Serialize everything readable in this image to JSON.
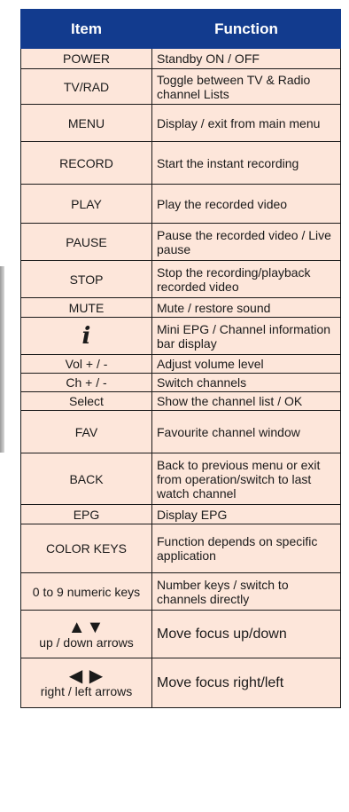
{
  "header": {
    "item": "Item",
    "function": "Function"
  },
  "rows": [
    {
      "item": "POWER",
      "function": "Standby ON / OFF"
    },
    {
      "item": "TV/RAD",
      "function": "Toggle between TV & Radio channel Lists"
    },
    {
      "item": "MENU",
      "function": "Display / exit from main menu"
    },
    {
      "item": "RECORD",
      "function": "Start the instant recording"
    },
    {
      "item": "PLAY",
      "function": "Play the recorded video"
    },
    {
      "item": "PAUSE",
      "function": "Pause the recorded video / Live pause"
    },
    {
      "item": "STOP",
      "function": "Stop the recording/playback recorded video"
    },
    {
      "item": "MUTE",
      "function": "Mute / restore sound"
    },
    {
      "item_icon": "info-i-icon",
      "item_glyph": "i",
      "function": "Mini EPG / Channel information bar display"
    },
    {
      "item": "Vol + / -",
      "function": "Adjust volume level"
    },
    {
      "item": "Ch + / -",
      "function": "Switch channels"
    },
    {
      "item": "Select",
      "function": "Show the channel list / OK"
    },
    {
      "item": "FAV",
      "function": "Favourite channel window"
    },
    {
      "item": "BACK",
      "function": "Back to previous menu or exit from operation/switch to last watch channel"
    },
    {
      "item": "EPG",
      "function": "Display EPG"
    },
    {
      "item": "COLOR KEYS",
      "function": "Function depends on specific application"
    },
    {
      "item": "0 to 9 numeric keys",
      "function": "Number keys / switch to channels directly"
    },
    {
      "item_icon": "up-down-arrows-icon",
      "item_glyph": "▲▼",
      "item": "up / down arrows",
      "function": "Move focus up/down"
    },
    {
      "item_icon": "right-left-arrows-icon",
      "item_glyph": "◀ ▶",
      "item": "right / left arrows",
      "function": "Move focus right/left"
    }
  ]
}
